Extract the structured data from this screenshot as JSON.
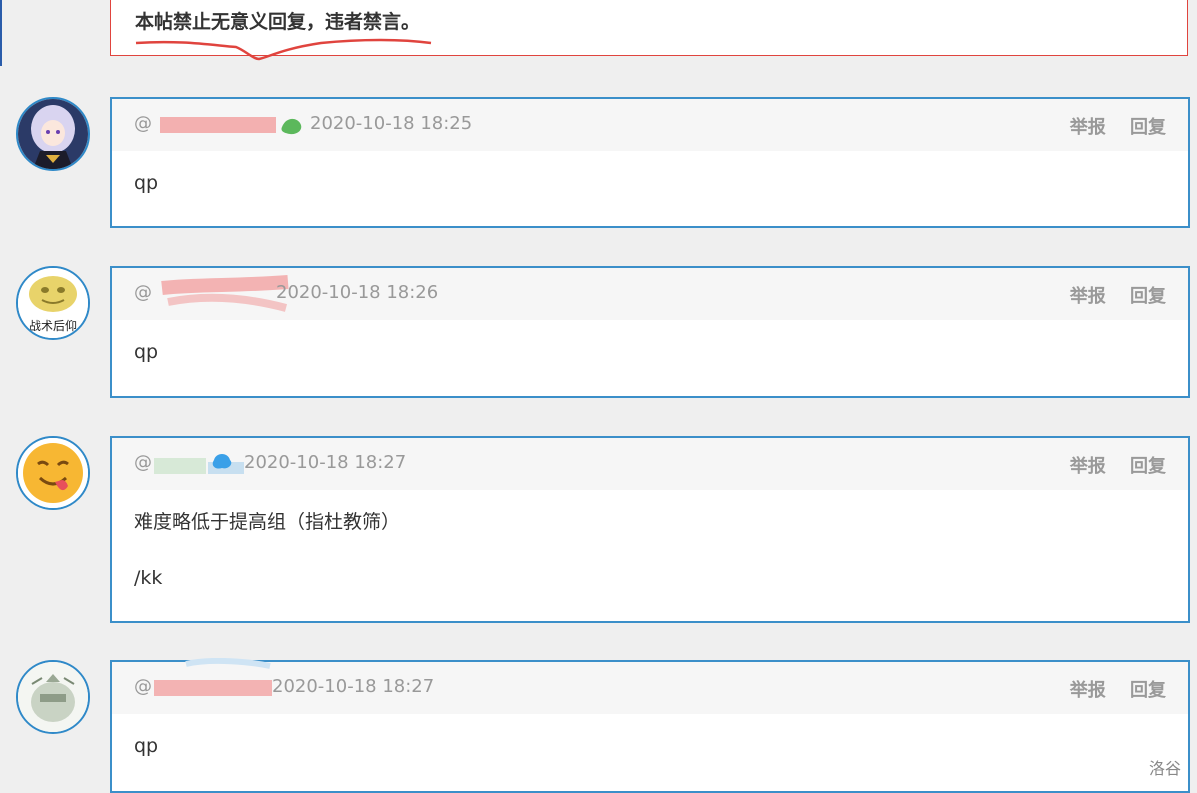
{
  "notice": {
    "text": "本帖禁止无意义回复，违者禁言。"
  },
  "comments": [
    {
      "at": "@",
      "time": "2020-10-18 18:25",
      "report": "举报",
      "reply": "回复",
      "lines": [
        "qp"
      ]
    },
    {
      "at": "@",
      "time": "2020-10-18 18:26",
      "report": "举报",
      "reply": "回复",
      "lines": [
        "qp"
      ]
    },
    {
      "at": "@",
      "time": "2020-10-18 18:27",
      "report": "举报",
      "reply": "回复",
      "lines": [
        "难度略低于提高组（指杜教筛）",
        "/kk"
      ]
    },
    {
      "at": "@",
      "time": "2020-10-18 18:27",
      "report": "举报",
      "reply": "回复",
      "lines": [
        "qp"
      ]
    }
  ],
  "avatars": {
    "c0": {
      "caption": ""
    },
    "c1": {
      "caption": "战术后仰"
    },
    "c2": {
      "caption": ""
    },
    "c3": {
      "caption": ""
    }
  },
  "watermark": "洛谷",
  "colors": {
    "accent": "#3b8fc9",
    "notice_border": "#e0443e",
    "redact": "#f2a3a3",
    "badge_green": "#5cb85c",
    "badge_blue": "#3aa0e8"
  }
}
